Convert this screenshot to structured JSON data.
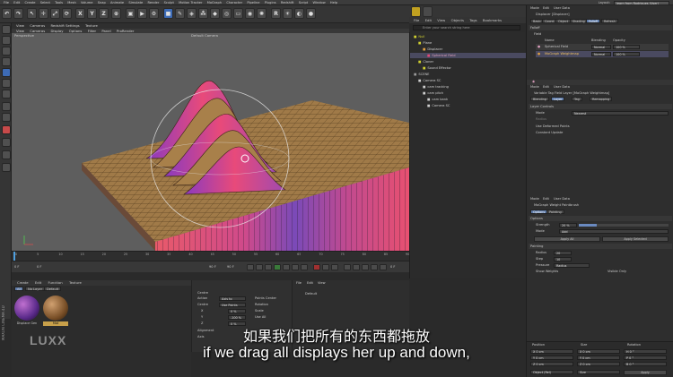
{
  "menubar": {
    "items": [
      "File",
      "Edit",
      "Create",
      "Select",
      "Tools",
      "Mesh",
      "Volume",
      "Snap",
      "Animate",
      "Simulate",
      "Render",
      "Sculpt",
      "Motion Tracker",
      "MoGraph",
      "Character",
      "Pipeline",
      "Plugins",
      "Redshift",
      "Script",
      "Window",
      "Help"
    ],
    "layout_label": "Layout:",
    "layout_value": "learn from Rodrigues (User)"
  },
  "toolbar": {
    "axis_x": "X",
    "axis_y": "Y",
    "axis_z": "Z"
  },
  "viewport": {
    "menu": [
      "View",
      "Cameras",
      "Display",
      "Options",
      "Filter",
      "Panel",
      "ProRender"
    ],
    "sub_menu": [
      "View",
      "Cameras",
      "Redshift Settings",
      "Texture"
    ],
    "label_perspective": "Perspective",
    "label_camera": "Default Camera",
    "colors": {
      "grid": "#8a6a3a",
      "bg": "#5e5e5e",
      "wave_top": "#b88a52",
      "gradient_pink": "#e34a7a",
      "gradient_purple": "#7a4ab8"
    }
  },
  "timeline": {
    "ticks": [
      "0",
      "5",
      "10",
      "15",
      "20",
      "25",
      "30",
      "35",
      "40",
      "45",
      "50",
      "55",
      "60",
      "65",
      "70",
      "75",
      "80",
      "85",
      "90"
    ],
    "frame_start": "0 F",
    "frame_current": "0 F",
    "frame_end": "90 F",
    "frame_end2": "90 F",
    "frame_display": "0 F"
  },
  "materials": {
    "menu": [
      "Create",
      "Edit",
      "Function",
      "Texture"
    ],
    "filters": [
      "All",
      "No Layer",
      "Default"
    ],
    "items": [
      {
        "name": "Displace Gen"
      },
      {
        "name": "Mat"
      }
    ]
  },
  "coords": {
    "title": "Centre",
    "rows": [
      {
        "label": "Action",
        "value": "Axis to"
      },
      {
        "label": "Centre",
        "value": "Use Points"
      },
      {
        "label": "X",
        "value": "0 %"
      },
      {
        "label": "Y",
        "value": "-100 %"
      },
      {
        "label": "Z",
        "value": "0 %"
      }
    ],
    "align": "Alignment",
    "axis_lbl": "Axis",
    "checks": [
      "Points Center",
      "Rotation",
      "Scale",
      "Use All"
    ]
  },
  "objpanel2": {
    "menu": [
      "File",
      "Edit",
      "View"
    ],
    "layer": "Default"
  },
  "objects": {
    "menu": [
      "File",
      "Edit",
      "View",
      "Objects",
      "Tags",
      "Bookmarks"
    ],
    "search_placeholder": "Enter your search string here",
    "tree": [
      {
        "name": "Null",
        "indent": 0,
        "color": "#d0d030"
      },
      {
        "name": "Plane",
        "indent": 1,
        "color": "#d0d030"
      },
      {
        "name": "Displacer",
        "indent": 2,
        "color": "#e0a040"
      },
      {
        "name": "Spherical Field",
        "indent": 3,
        "color": "#e34a7a"
      },
      {
        "name": "Cloner",
        "indent": 1,
        "color": "#d0d030"
      },
      {
        "name": "Sound Effector",
        "indent": 2,
        "color": "#d0d030"
      },
      {
        "name": "SCENE",
        "indent": 0,
        "color": "#9a9a9a"
      },
      {
        "name": "Camera SC",
        "indent": 1,
        "color": "#d0d0d0"
      },
      {
        "name": "cam tracking",
        "indent": 2,
        "color": "#d0d0d0"
      },
      {
        "name": "cam pitch",
        "indent": 2,
        "color": "#d0d0d0"
      },
      {
        "name": "cam bank",
        "indent": 3,
        "color": "#d0d0d0"
      },
      {
        "name": "Camera SC",
        "indent": 3,
        "color": "#d0d0d0"
      }
    ]
  },
  "attrs": {
    "menu": [
      "Mode",
      "Edit",
      "User Data"
    ],
    "title": "Displacer [Displacer]",
    "tabs": [
      "Basic",
      "Coord.",
      "Object",
      "Shading",
      "Falloff",
      "Refresh"
    ],
    "active_tab": "Falloff",
    "section_field": "Falloff",
    "field_header": "Field",
    "columns": [
      "Name",
      "Blending",
      "Opacity"
    ],
    "fields": [
      {
        "name": "Spherical Field",
        "blend": "Normal",
        "opacity": "100 %"
      },
      {
        "name": "MoGraph Weightmap",
        "blend": "Normal",
        "opacity": "100 %"
      }
    ]
  },
  "tagattrs": {
    "menu": [
      "Mode",
      "Edit",
      "User Data"
    ],
    "title": "Variable Tag Field Layer [MoGraph Weightmap]",
    "tabs": [
      "Blending",
      "Layer",
      "Tag",
      "Remapping"
    ],
    "active_tab": "Layer",
    "section": "Layer Controls",
    "rows": [
      {
        "label": "Mode",
        "value": "Nearest"
      },
      {
        "label": "Radius",
        "value": ""
      }
    ],
    "checks": [
      "Use Deformed Points",
      "Constant Update"
    ]
  },
  "weightattrs": {
    "menu": [
      "Mode",
      "Edit",
      "User Data"
    ],
    "title": "MoGraph Weight Paintbrush",
    "tabs": [
      "Options",
      "Painting"
    ],
    "options_section": "Options",
    "rows": [
      {
        "label": "Strength",
        "value": "20 %"
      },
      {
        "label": "Mode",
        "value": "Add"
      }
    ],
    "btn_apply": "Apply All",
    "btn_apply_sel": "Apply Selected",
    "painting_section": "Painting",
    "prows": [
      {
        "label": "Radius",
        "value": "20"
      },
      {
        "label": "Step",
        "value": "10"
      },
      {
        "label": "Pressure",
        "value": "Radius"
      }
    ],
    "show_weights": "Show Weights",
    "visible_only": "Visible Only"
  },
  "coordmgr": {
    "headers": [
      "Position",
      "Size",
      "Rotation"
    ],
    "rows": [
      {
        "pos": "X  0 cm",
        "size": "X  0 cm",
        "rot": "H  0 °"
      },
      {
        "pos": "Y  0 cm",
        "size": "Y  0 cm",
        "rot": "P  0 °"
      },
      {
        "pos": "Z  0 cm",
        "size": "Z  0 cm",
        "rot": "B  0 °"
      }
    ],
    "mode": "Object (Rel)",
    "size_mode": "Size",
    "apply": "Apply"
  },
  "subtitles": {
    "cn": "如果我们把所有的东西都拖放",
    "en": "if we drag all displays her up and down,"
  },
  "watermark": {
    "luxx": "LUXX",
    "maxon": "MAXON CINEMA 4D"
  }
}
